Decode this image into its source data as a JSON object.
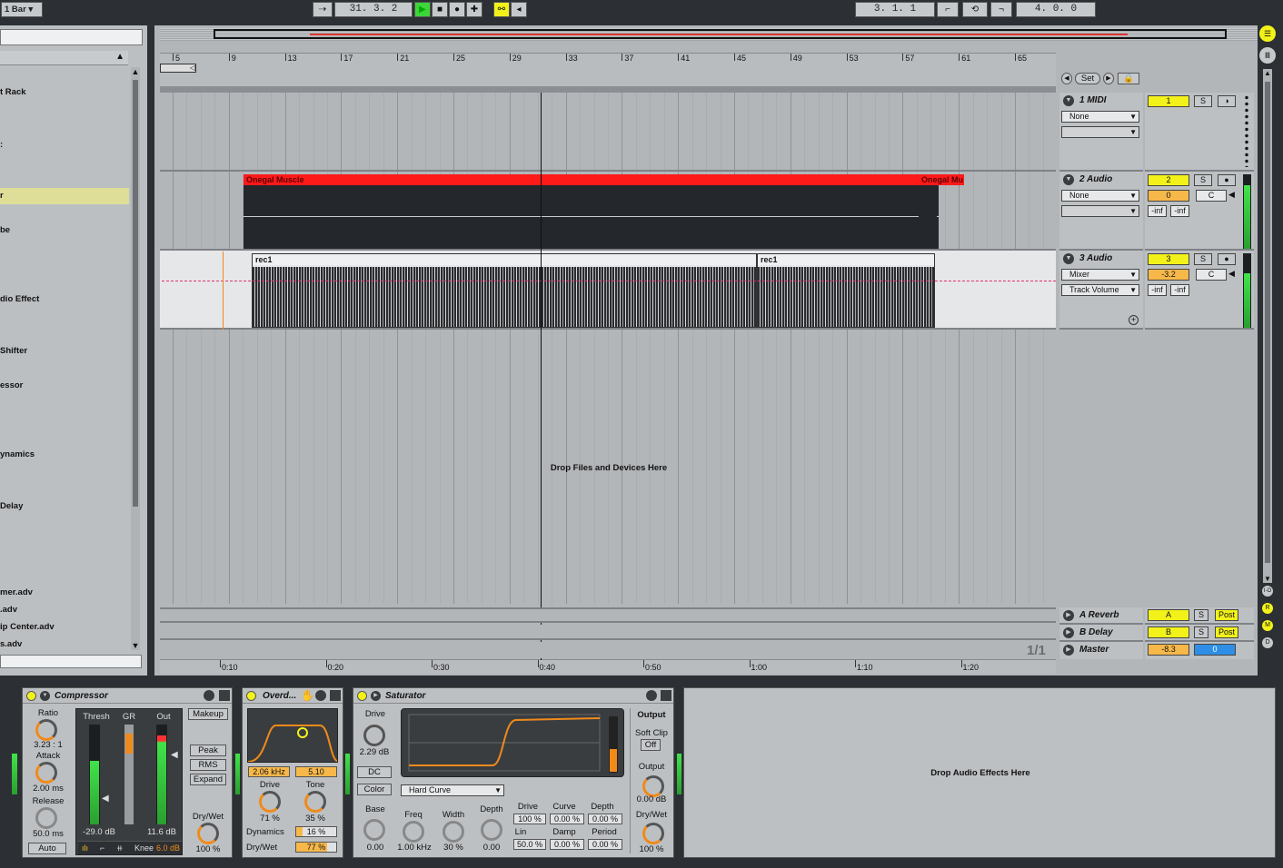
{
  "transport": {
    "quantize": "1 Bar",
    "position": "31.  3.  2",
    "loop_start": "3.  1.  1",
    "loop_length": "4.  0.  0"
  },
  "browser": {
    "items": [
      "t Rack",
      ":",
      "r",
      "be",
      "dio Effect",
      "Shifter",
      "essor",
      "ynamics",
      "Delay",
      "mer.adv",
      ".adv",
      "ip Center.adv",
      "s.adv"
    ],
    "selected_index": 2
  },
  "ruler": {
    "bars": [
      "5",
      "9",
      "13",
      "17",
      "21",
      "25",
      "29",
      "33",
      "37",
      "41",
      "45",
      "49",
      "53",
      "57",
      "61",
      "65"
    ],
    "times": [
      "0:10",
      "0:20",
      "0:30",
      "0:40",
      "0:50",
      "1:00",
      "1:10",
      "1:20"
    ],
    "set_label": "Set"
  },
  "arrangement": {
    "drop_text": "Drop Files and Devices Here",
    "clips": {
      "audio2_a": "Onegal Muscle",
      "audio2_b": "Onegal Mu",
      "audio3_a": "rec1",
      "audio3_b": "rec1"
    },
    "page_indicator": "1/1"
  },
  "tracks": [
    {
      "name": "1 MIDI",
      "number": "1",
      "solo": "S",
      "input": "None",
      "volume": "",
      "pan": ""
    },
    {
      "name": "2 Audio",
      "number": "2",
      "solo": "S",
      "input": "None",
      "volume": "0",
      "pan": "C",
      "send_l": "-inf",
      "send_r": "-inf"
    },
    {
      "name": "3 Audio",
      "number": "3",
      "solo": "S",
      "input": "Mixer",
      "input2": "Track Volume",
      "volume": "-3.2",
      "pan": "C",
      "send_l": "-inf",
      "send_r": "-inf"
    }
  ],
  "returns": [
    {
      "name": "A Reverb",
      "number": "A",
      "solo": "S",
      "post": "Post"
    },
    {
      "name": "B Delay",
      "number": "B",
      "solo": "S",
      "post": "Post"
    },
    {
      "name": "Master",
      "volume": "-8.3",
      "cue": "0"
    }
  ],
  "right_strip": [
    "I-O",
    "R",
    "M",
    "D"
  ],
  "devices": {
    "compressor": {
      "title": "Compressor",
      "ratio_label": "Ratio",
      "ratio_value": "3.23 : 1",
      "attack_label": "Attack",
      "attack_value": "2.00 ms",
      "release_label": "Release",
      "release_value": "50.0 ms",
      "auto": "Auto",
      "thresh_label": "Thresh",
      "gr_label": "GR",
      "out_label": "Out",
      "thresh_value": "-29.0 dB",
      "out_value": "11.6 dB",
      "knee_label": "Knee",
      "knee_value": "6.0 dB",
      "makeup": "Makeup",
      "peak": "Peak",
      "rms": "RMS",
      "expand": "Expand",
      "drywet_label": "Dry/Wet",
      "drywet_value": "100 %"
    },
    "overdrive": {
      "title": "Overd...",
      "freq": "2.06 kHz",
      "width": "5.10",
      "drive_label": "Drive",
      "drive_value": "71 %",
      "tone_label": "Tone",
      "tone_value": "35 %",
      "dynamics_label": "Dynamics",
      "dynamics_value": "16 %",
      "drywet_label": "Dry/Wet",
      "drywet_value": "77 %"
    },
    "saturator": {
      "title": "Saturator",
      "drive_label": "Drive",
      "drive_value": "2.29 dB",
      "dc": "DC",
      "color": "Color",
      "curve_type": "Hard Curve",
      "output_section": "Output",
      "softclip_label": "Soft Clip",
      "softclip_value": "Off",
      "output_label": "Output",
      "output_value": "0.00 dB",
      "drywet_label": "Dry/Wet",
      "drywet_value": "100 %",
      "base_label": "Base",
      "base_value": "0.00",
      "freq_label": "Freq",
      "freq_value": "1.00 kHz",
      "width_label": "Width",
      "width_value": "30 %",
      "depth_label": "Depth",
      "depth_value": "0.00",
      "p_drive_label": "Drive",
      "p_drive_value": "100 %",
      "p_curve_label": "Curve",
      "p_curve_value": "0.00 %",
      "p_depth_label": "Depth",
      "p_depth_value": "0.00 %",
      "p_lin_label": "Lin",
      "p_lin_value": "50.0 %",
      "p_damp_label": "Damp",
      "p_damp_value": "0.00 %",
      "p_period_label": "Period",
      "p_period_value": "0.00 %"
    },
    "drop_text": "Drop Audio Effects Here"
  },
  "colors": {
    "clip_red": "#ff1a1a",
    "accent_yellow": "#f2f21a",
    "accent_orange": "#f08a1a",
    "meter_green": "#41e34a"
  }
}
